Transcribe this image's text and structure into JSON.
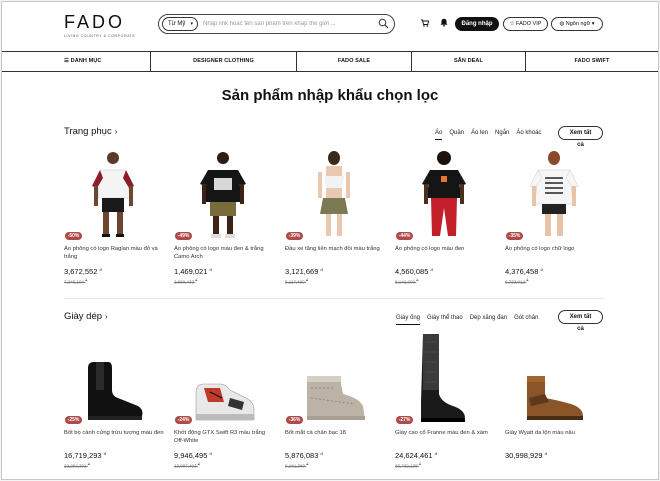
{
  "header": {
    "logo_text": "FADO",
    "logo_tagline": "LIVING COUNTRY & CORPORATE",
    "search": {
      "country": "Từ Mỹ",
      "placeholder": "Nhập link hoặc tên sản phẩm trên khắp thế giới ..."
    },
    "login_label": "Đăng nhập",
    "vip_label": "FADO VIP",
    "lang_label": "Ngôn ngữ"
  },
  "nav": {
    "items": [
      {
        "label": "DANH MỤC"
      },
      {
        "label": "DESIGNER CLOTHING"
      },
      {
        "label": "FADO SALE"
      },
      {
        "label": "SĂN DEAL"
      },
      {
        "label": "FADO SWIFT"
      }
    ]
  },
  "page_title": "Sản phẩm nhập khẩu chọn lọc",
  "sections": [
    {
      "title": "Trang phục",
      "tabs": [
        "Áo",
        "Quần",
        "Áo len",
        "Ngắn",
        "Áo khoác"
      ],
      "active_tab": 0,
      "see_all": "Xem tất cả",
      "products": [
        {
          "discount": "-50%",
          "name": "Áo phông có logo Raglan màu đỏ và trắng",
          "price": "3,672,552",
          "old_price": "7,345,104",
          "currency": "đ"
        },
        {
          "discount": "-49%",
          "name": "Áo phông có logo màu đen & trắng Camo Arch",
          "price": "1,469,021",
          "old_price": "2,880,433",
          "currency": "đ"
        },
        {
          "discount": "-39%",
          "name": "Đầu xe tăng liền mạch đồi màu trắng",
          "price": "3,121,669",
          "old_price": "5,117,490",
          "currency": "đ"
        },
        {
          "discount": "-44%",
          "name": "Áo phông có logo màu đen",
          "price": "4,560,085",
          "old_price": "8,142,009",
          "currency": "đ"
        },
        {
          "discount": "-35%",
          "name": "Áo phông có logo chữ logo",
          "price": "4,376,458",
          "old_price": "6,733,012",
          "currency": "đ"
        }
      ]
    },
    {
      "title": "Giày dép",
      "tabs": [
        "Giày ống",
        "Giày thể thao",
        "Dép xăng đan",
        "Gót chân"
      ],
      "active_tab": 0,
      "see_all": "Xem tất cả",
      "products": [
        {
          "discount": "-25%",
          "name": "Bốt bọ cánh cứng trừu tượng màu đen",
          "price": "16,719,293",
          "old_price": "22,292,391",
          "currency": "đ"
        },
        {
          "discount": "-24%",
          "name": "Khởi động GTX Swift R3 màu trắng Off-White",
          "price": "9,946,495",
          "old_price": "13,087,493",
          "currency": "đ"
        },
        {
          "discount": "-36%",
          "name": "Bốt mắt cá chân bạc 18",
          "price": "5,876,083",
          "old_price": "9,181,380",
          "currency": "đ"
        },
        {
          "discount": "-27%",
          "name": "Giày cao cổ Franne màu đen & xám",
          "price": "24,624,461",
          "old_price": "33,732,138",
          "currency": "đ"
        },
        {
          "discount": "",
          "name": "Giày Wyatt da lộn màu nâu",
          "price": "30,998,929",
          "old_price": "",
          "currency": "đ"
        }
      ]
    }
  ],
  "icons": {
    "search": "search-icon",
    "cart": "cart-icon",
    "bell": "bell-icon",
    "menu": "hamburger-icon",
    "star": "star-icon",
    "globe": "globe-icon"
  },
  "colors": {
    "badge": "#ae4a4a",
    "primary": "#111111"
  }
}
